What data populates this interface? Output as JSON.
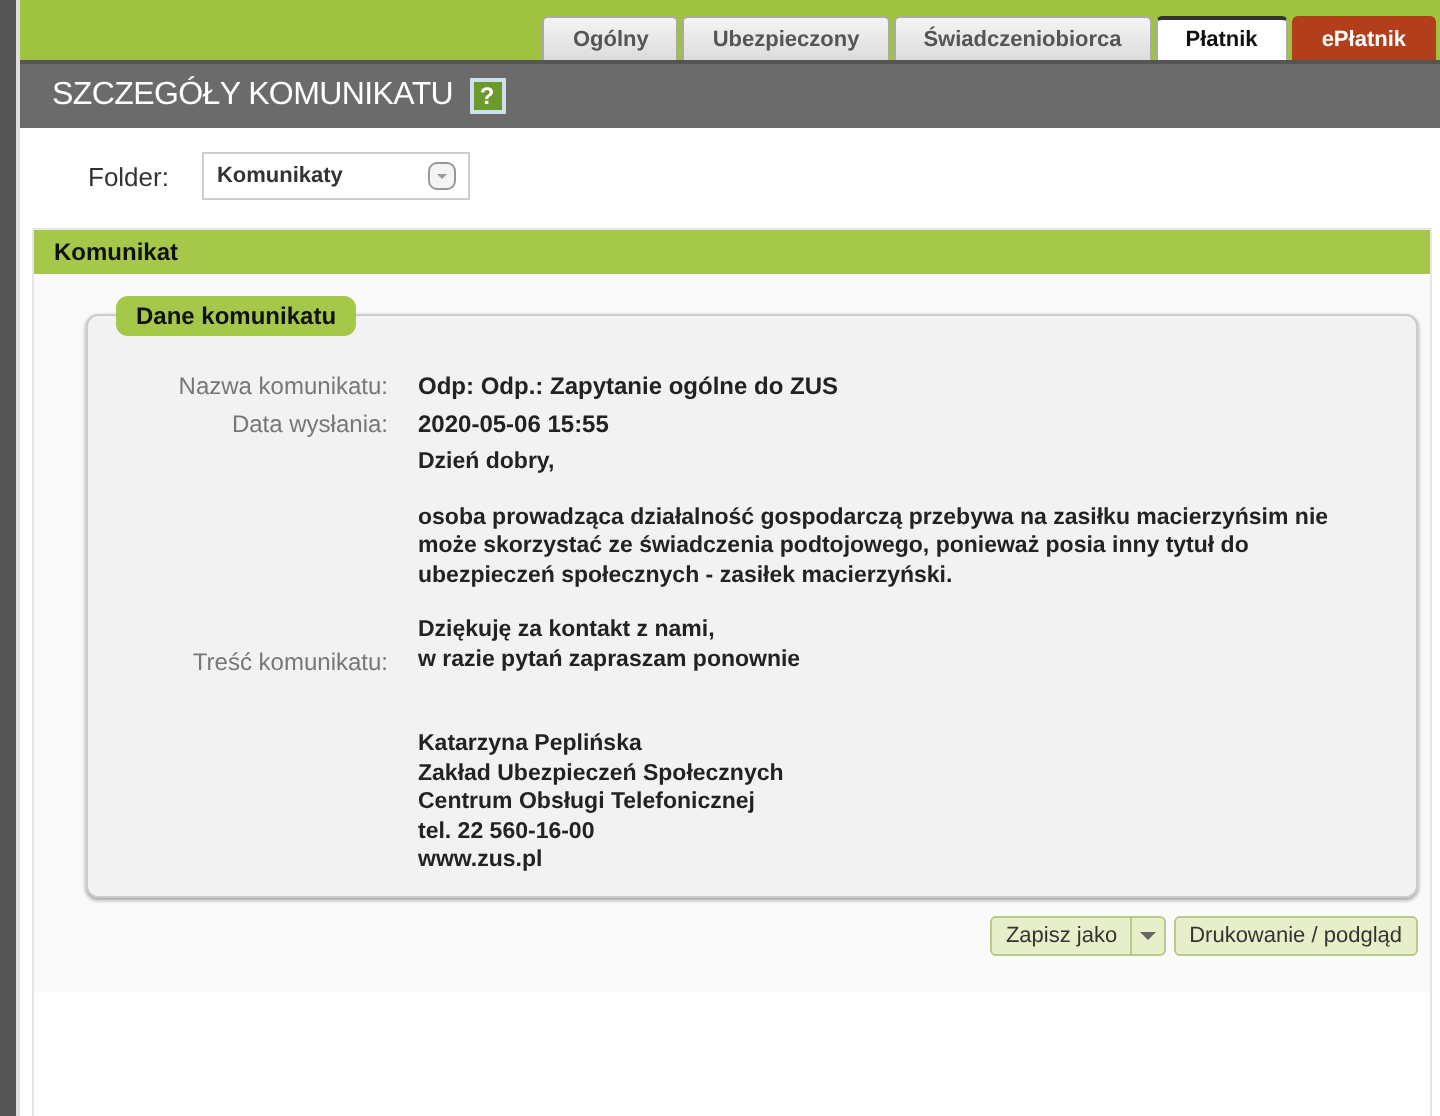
{
  "tabs": [
    {
      "label": "Ogólny",
      "selected": false,
      "kind": "normal"
    },
    {
      "label": "Ubezpieczony",
      "selected": false,
      "kind": "normal"
    },
    {
      "label": "Świadczeniobiorca",
      "selected": false,
      "kind": "normal"
    },
    {
      "label": "Płatnik",
      "selected": true,
      "kind": "normal"
    },
    {
      "label": "ePłatnik",
      "selected": false,
      "kind": "accent"
    }
  ],
  "header": {
    "title": "SZCZEGÓŁY KOMUNIKATU",
    "help": "?"
  },
  "folder": {
    "label": "Folder:",
    "value": "Komunikaty"
  },
  "section": {
    "title": "Komunikat"
  },
  "group": {
    "title": "Dane komunikatu",
    "fields": [
      {
        "label": "Nazwa komunikatu:",
        "value": "Odp: Odp.: Zapytanie ogólne do ZUS"
      },
      {
        "label": "Data wysłania:",
        "value": "2020-05-06 15:55"
      }
    ],
    "body_label": "Treść komunikatu:",
    "body": [
      [
        "Dzień dobry,"
      ],
      [
        "osoba prowadząca działalność gospodarczą przebywa na zasiłku macierzyńsim nie",
        "może skorzystać ze świadczenia podtojowego, ponieważ posia inny tytuł do",
        "ubezpieczeń społecznych - zasiłek macierzyński."
      ],
      [
        "Dziękuję za kontakt z nami,",
        "w razie pytań zapraszam ponownie"
      ],
      [
        "Katarzyna Peplińska",
        "Zakład Ubezpieczeń Społecznych",
        "Centrum Obsługi Telefonicznej",
        "tel. 22 560-16-00",
        "www.zus.pl"
      ]
    ]
  },
  "buttons": {
    "save": "Zapisz jako",
    "print": "Drukowanie / podgląd"
  }
}
